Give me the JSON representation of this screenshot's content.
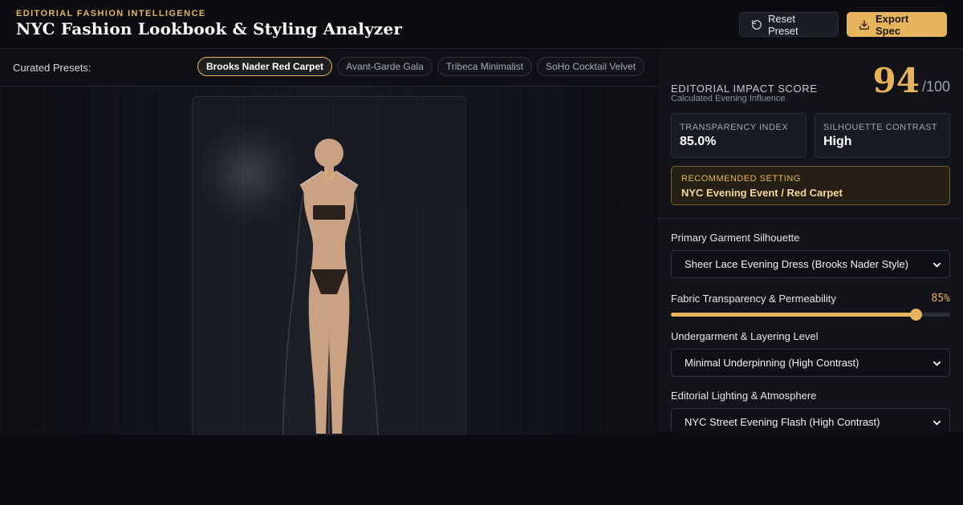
{
  "header": {
    "kicker": "EDITORIAL FASHION INTELLIGENCE",
    "title": "NYC Fashion Lookbook & Styling Analyzer",
    "reset_label": "Reset Preset",
    "export_label": "Export Spec"
  },
  "presets": {
    "label": "Curated Presets:",
    "items": [
      {
        "label": "Brooks Nader Red Carpet",
        "active": true
      },
      {
        "label": "Avant-Garde Gala",
        "active": false
      },
      {
        "label": "Tribeca Minimalist",
        "active": false
      },
      {
        "label": "SoHo Cocktail Velvet",
        "active": false
      }
    ]
  },
  "score": {
    "label": "EDITORIAL IMPACT SCORE",
    "sublabel": "Calculated Evening Influence",
    "value": "94",
    "max": "/100"
  },
  "stats": [
    {
      "label": "TRANSPARENCY INDEX",
      "value": "85.0%"
    },
    {
      "label": "SILHOUETTE CONTRAST",
      "value": "High"
    }
  ],
  "recommended": {
    "label": "RECOMMENDED SETTING",
    "value": "NYC Evening Event / Red Carpet"
  },
  "controls": {
    "silhouette": {
      "label": "Primary Garment Silhouette",
      "value": "Sheer Lace Evening Dress (Brooks Nader Style)"
    },
    "transparency": {
      "label": "Fabric Transparency & Permeability",
      "display": "85%",
      "fraction": 0.875
    },
    "undergarment": {
      "label": "Undergarment & Layering Level",
      "value": "Minimal Underpinning (High Contrast)"
    },
    "lighting": {
      "label": "Editorial Lighting & Atmosphere",
      "value": "NYC Street Evening Flash (High Contrast)"
    }
  },
  "colors": {
    "accent": "#e6b45c",
    "skin": "#c9a283",
    "underpinning": "#2a211c"
  }
}
